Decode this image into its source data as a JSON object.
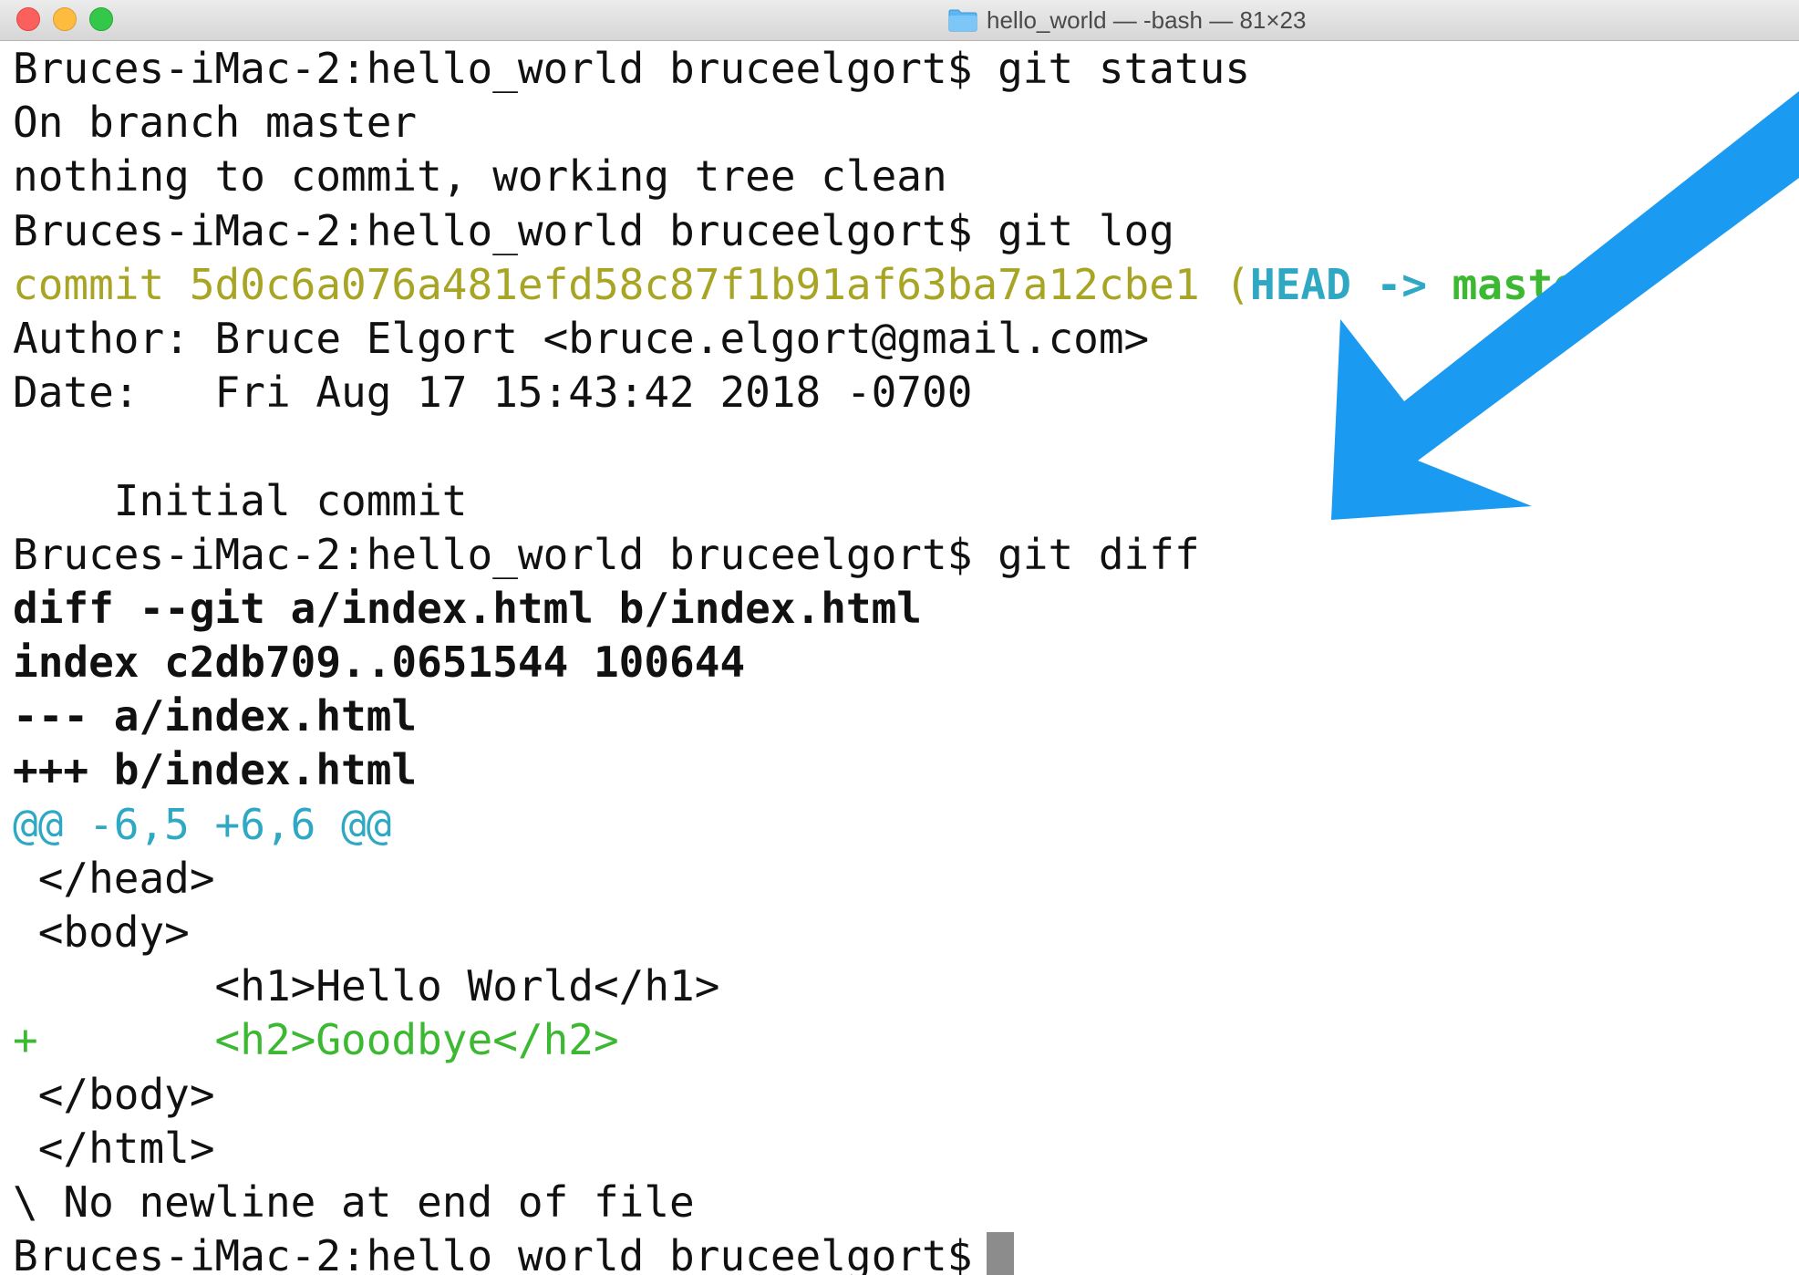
{
  "window": {
    "title": "hello_world — -bash — 81×23",
    "traffic_lights": [
      "close",
      "minimize",
      "zoom"
    ],
    "colors": {
      "commit_line": "#a8a424",
      "head_ref": "#2fa8c4",
      "branch_ref": "#3cb832",
      "hunk_header": "#2fa8c4",
      "added_line": "#3cb832",
      "arrow": "#1a9af0"
    }
  },
  "terminal": {
    "l1": "Bruces-iMac-2:hello_world bruceelgort$ git status",
    "l2": "On branch master",
    "l3": "nothing to commit, working tree clean",
    "l4": "Bruces-iMac-2:hello_world bruceelgort$ git log",
    "l5_commit": "commit 5d0c6a076a481efd58c87f1b91af63ba7a12cbe1 ",
    "l5_paren_open": "(",
    "l5_head": "HEAD -> ",
    "l5_branch": "master",
    "l5_paren_close": ")",
    "l6": "Author: Bruce Elgort <bruce.elgort@gmail.com>",
    "l7": "Date:   Fri Aug 17 15:43:42 2018 -0700",
    "l8": "",
    "l9": "    Initial commit",
    "l10": "Bruces-iMac-2:hello_world bruceelgort$ git diff",
    "l11": "diff --git a/index.html b/index.html",
    "l12": "index c2db709..0651544 100644",
    "l13": "--- a/index.html",
    "l14": "+++ b/index.html",
    "l15": "@@ -6,5 +6,6 @@",
    "l16": " </head>",
    "l17": " <body>",
    "l18": "        <h1>Hello World</h1>",
    "l19": "+       <h2>Goodbye</h2>",
    "l20": " </body>",
    "l21": " </html>",
    "l22": "\\ No newline at end of file",
    "l23": "Bruces-iMac-2:hello_world bruceelgort$"
  }
}
